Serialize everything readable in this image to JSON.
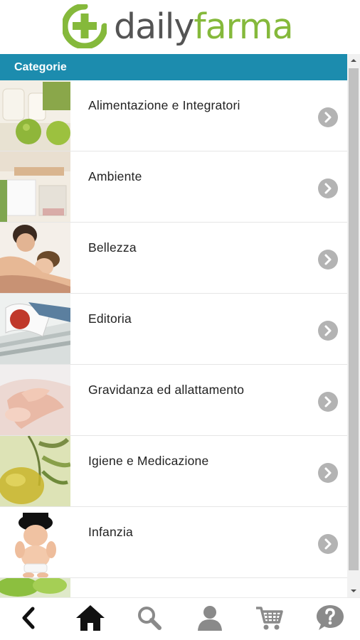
{
  "brand": {
    "name_part1": "daily",
    "name_part2": "farma",
    "colors": {
      "green": "#85b93b",
      "grey": "#545454",
      "header": "#1c8cae"
    }
  },
  "categories_header": "Categorie",
  "categories": [
    {
      "label": "Alimentazione e Integratori",
      "image": "apples-jars-photo"
    },
    {
      "label": "Ambiente",
      "image": "kitchen-room-photo"
    },
    {
      "label": "Bellezza",
      "image": "couple-relaxing-photo"
    },
    {
      "label": "Editoria",
      "image": "magazines-stack-photo"
    },
    {
      "label": "Gravidanza ed allattamento",
      "image": "baby-hands-photo"
    },
    {
      "label": "Igiene e Medicazione",
      "image": "herbs-oil-photo"
    },
    {
      "label": "Infanzia",
      "image": "baby-hat-photo"
    },
    {
      "label": "",
      "image": "green-leaves-photo"
    }
  ],
  "bottom_nav": [
    {
      "name": "back",
      "icon": "chevron-left-icon"
    },
    {
      "name": "home",
      "icon": "home-icon"
    },
    {
      "name": "search",
      "icon": "search-icon"
    },
    {
      "name": "account",
      "icon": "user-icon"
    },
    {
      "name": "cart",
      "icon": "cart-icon"
    },
    {
      "name": "help",
      "icon": "help-icon"
    }
  ]
}
